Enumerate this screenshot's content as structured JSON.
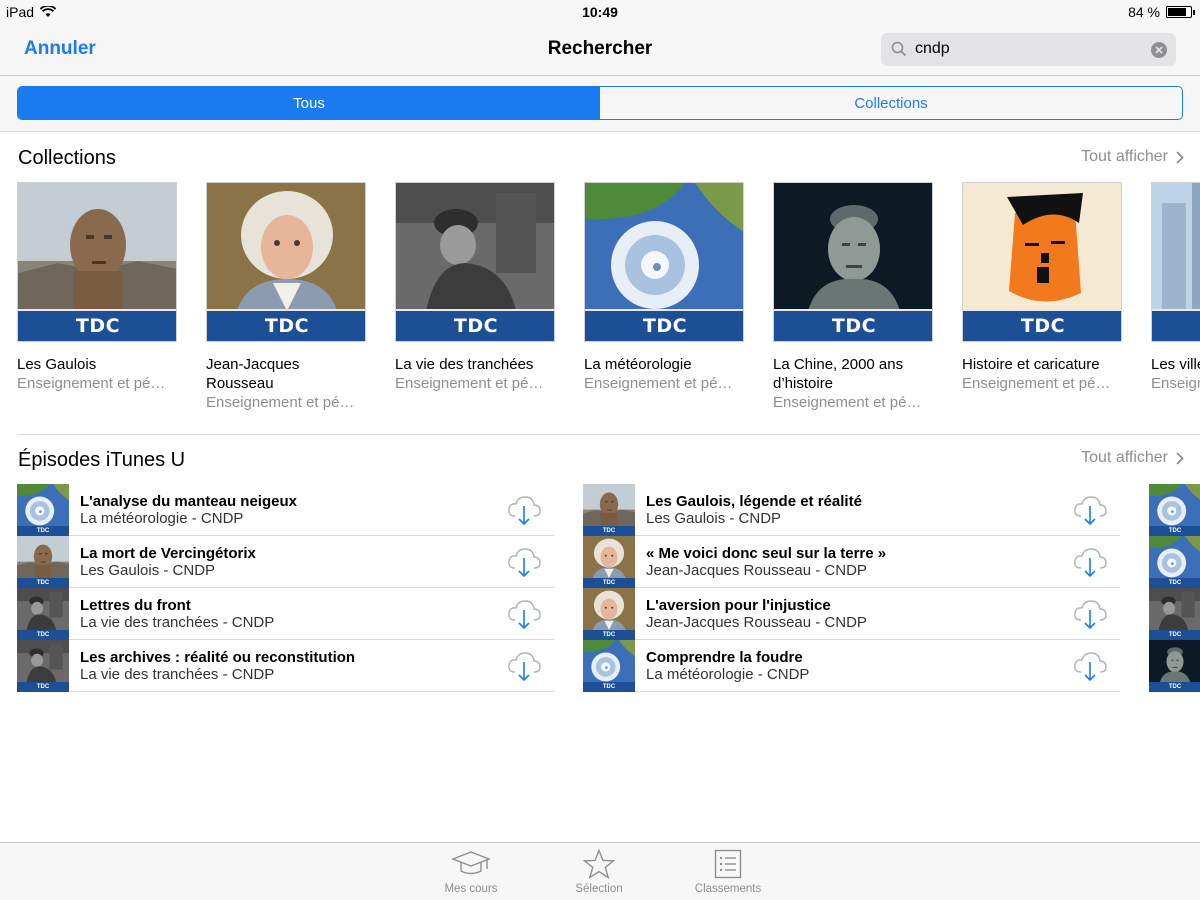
{
  "status_bar": {
    "device": "iPad",
    "time": "10:49",
    "battery_text": "84 %",
    "battery_level": 0.84
  },
  "nav": {
    "cancel_label": "Annuler",
    "title": "Rechercher",
    "search_value": "cndp"
  },
  "segments": [
    {
      "label": "Tous",
      "selected": true
    },
    {
      "label": "Collections",
      "selected": false
    }
  ],
  "collections_section": {
    "title": "Collections",
    "see_all_label": "Tout afficher",
    "items": [
      {
        "title": "Les Gaulois",
        "subtitle": "Enseignement et pé…",
        "badge": "TDC",
        "art": "gaulois"
      },
      {
        "title": "Jean-Jacques Rousseau",
        "subtitle": "Enseignement et pé…",
        "badge": "TDC",
        "art": "rousseau"
      },
      {
        "title": "La vie des tranchées",
        "subtitle": "Enseignement et pé…",
        "badge": "TDC",
        "art": "tranchees"
      },
      {
        "title": "La météorologie",
        "subtitle": "Enseignement et pé…",
        "badge": "TDC",
        "art": "meteo"
      },
      {
        "title": "La Chine, 2000 ans d’histoire",
        "subtitle": "Enseignement et pé…",
        "badge": "TDC",
        "art": "chine"
      },
      {
        "title": "Histoire et caricature",
        "subtitle": "Enseignement et pé…",
        "badge": "TDC",
        "art": "caricature"
      },
      {
        "title": "Les ville",
        "subtitle": "Enseign",
        "badge": "TDC",
        "art": "villes"
      }
    ]
  },
  "episodes_section": {
    "title": "Épisodes iTunes U",
    "see_all_label": "Tout afficher",
    "columns": [
      [
        {
          "title": "L'analyse du manteau neigeux",
          "subtitle": "La météorologie - CNDP",
          "art": "meteo"
        },
        {
          "title": "La mort de Vercingétorix",
          "subtitle": "Les Gaulois - CNDP",
          "art": "gaulois"
        },
        {
          "title": "Lettres du front",
          "subtitle": "La vie des tranchées - CNDP",
          "art": "tranchees"
        },
        {
          "title": "Les archives : réalité ou reconstitution",
          "subtitle": "La vie des tranchées - CNDP",
          "art": "tranchees"
        }
      ],
      [
        {
          "title": "Les Gaulois, légende et réalité",
          "subtitle": "Les Gaulois - CNDP",
          "art": "gaulois"
        },
        {
          "title": "« Me voici donc seul sur la terre »",
          "subtitle": "Jean-Jacques Rousseau - CNDP",
          "art": "rousseau"
        },
        {
          "title": "L'aversion pour l'injustice",
          "subtitle": "Jean-Jacques Rousseau - CNDP",
          "art": "rousseau"
        },
        {
          "title": "Comprendre la foudre",
          "subtitle": "La météorologie - CNDP",
          "art": "meteo"
        }
      ],
      [
        {
          "title": "",
          "subtitle": "",
          "art": "meteo"
        },
        {
          "title": "",
          "subtitle": "",
          "art": "meteo"
        },
        {
          "title": "",
          "subtitle": "",
          "art": "tranchees"
        },
        {
          "title": "",
          "subtitle": "",
          "art": "chine"
        }
      ]
    ]
  },
  "tab_bar": {
    "tabs": [
      {
        "label": "Mes cours",
        "icon": "graduation-cap-icon"
      },
      {
        "label": "Sélection",
        "icon": "star-icon"
      },
      {
        "label": "Classements",
        "icon": "list-icon"
      }
    ]
  },
  "colors": {
    "accent": "#1a7cf0",
    "tdc_band": "#1c4f96",
    "secondary_text": "#8e8e93"
  }
}
